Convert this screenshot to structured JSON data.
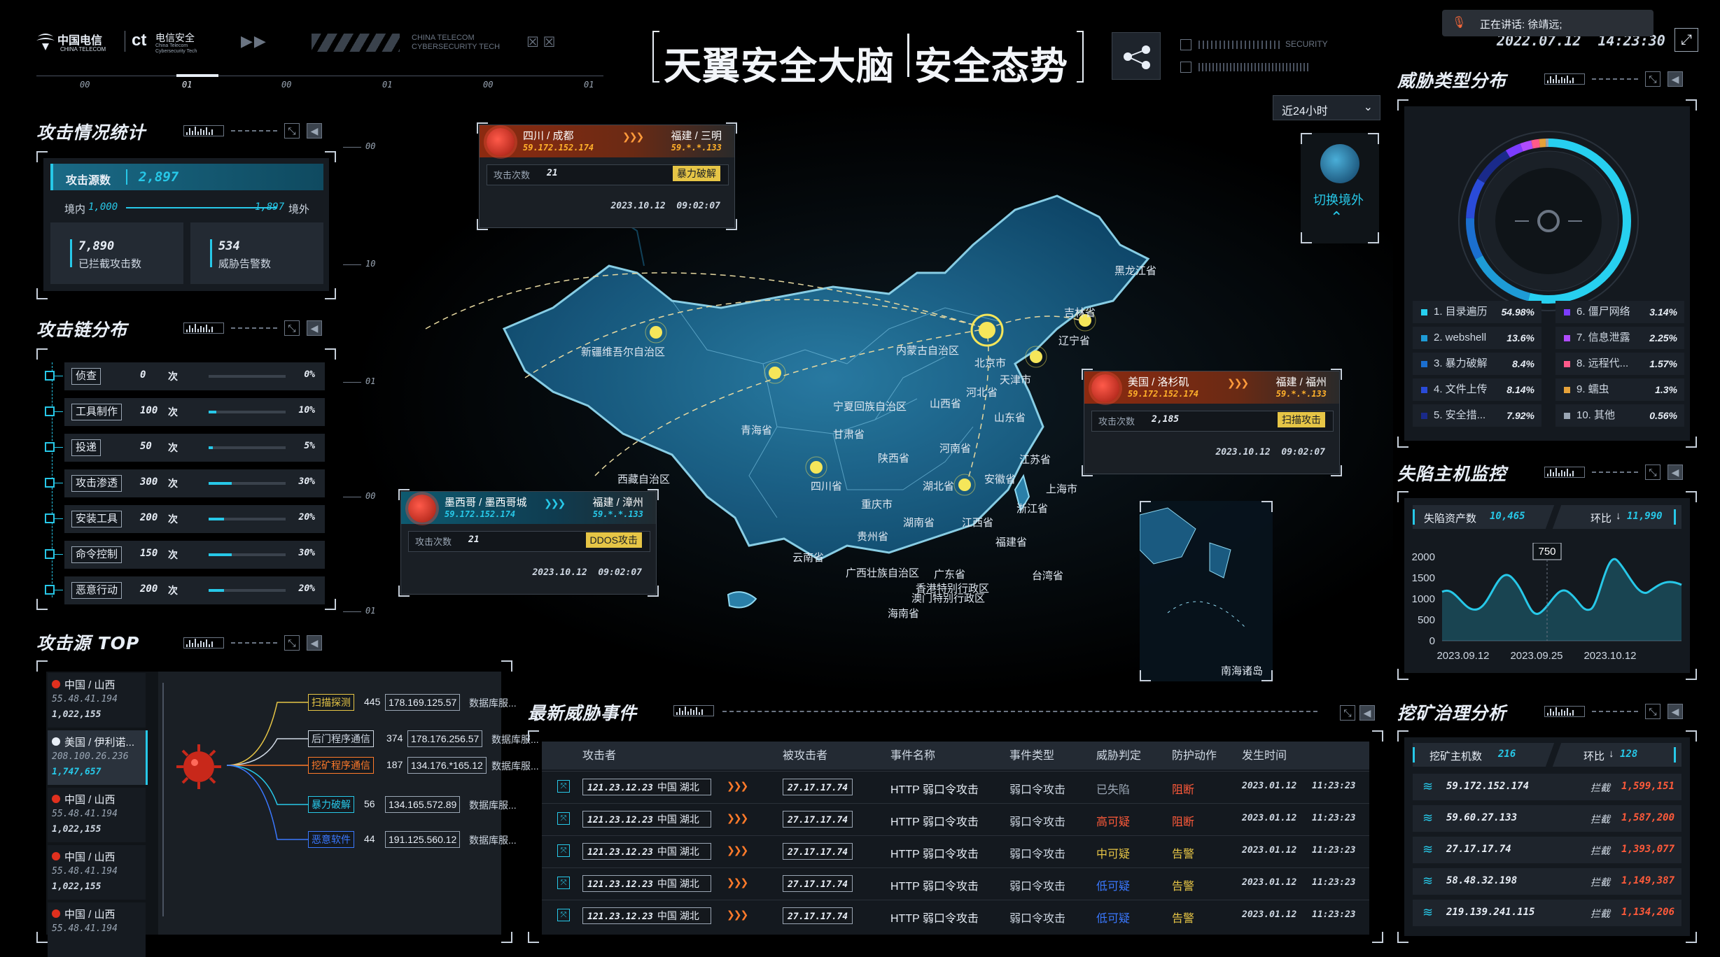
{
  "header": {
    "logo_text": "中国电信",
    "logo_sub": "CHINA TELECOM",
    "logo2_text": "电信安全",
    "logo2_sub": "China Telecom Cybersecurity Tech",
    "brand_en": "CHINA TELECOM\nCYBERSECURITY TECH",
    "title_part1": "天翼安全大脑",
    "title_part2": "安全态势",
    "security_label": "SECURITY",
    "datetime": "2022.07.12  14:23:30",
    "timeline_labels": [
      "00",
      "01",
      "00",
      "01",
      "00",
      "01"
    ],
    "speaking": "正在讲话: 徐靖远;"
  },
  "time_select": {
    "value": "近24小时"
  },
  "attack_stats": {
    "title": "攻击情况统计",
    "source_label": "攻击源数",
    "source_value": "2,897",
    "domestic_label": "境内",
    "domestic_value": "1,000",
    "foreign_value": "1,897",
    "foreign_label": "境外",
    "blocked_value": "7,890",
    "blocked_label": "已拦截攻击数",
    "alerts_value": "534",
    "alerts_label": "威胁告警数"
  },
  "attack_chain": {
    "title": "攻击链分布",
    "unit": "次",
    "items": [
      {
        "label": "侦查",
        "count": "0",
        "pct": "0%",
        "level": 0
      },
      {
        "label": "工具制作",
        "count": "100",
        "pct": "10%",
        "level": 10
      },
      {
        "label": "投递",
        "count": "50",
        "pct": "5%",
        "level": 5
      },
      {
        "label": "攻击渗透",
        "count": "300",
        "pct": "30%",
        "level": 30
      },
      {
        "label": "安装工具",
        "count": "200",
        "pct": "20%",
        "level": 20
      },
      {
        "label": "命令控制",
        "count": "150",
        "pct": "30%",
        "level": 30
      },
      {
        "label": "恶意行动",
        "count": "200",
        "pct": "20%",
        "level": 20
      }
    ]
  },
  "attack_top": {
    "title": "攻击源 TOP",
    "sources": [
      {
        "place": "中国 / 山西",
        "ip": "55.48.41.194",
        "count": "1,022,155"
      },
      {
        "place": "美国 / 伊利诺...",
        "ip": "208.100.26.236",
        "count": "1,747,657"
      },
      {
        "place": "中国 / 山西",
        "ip": "55.48.41.194",
        "count": "1,022,155"
      },
      {
        "place": "中国 / 山西",
        "ip": "55.48.41.194",
        "count": "1,022,155"
      },
      {
        "place": "中国 / 山西",
        "ip": "55.48.41.194",
        "count": ""
      }
    ],
    "branches": [
      {
        "type": "扫描探测",
        "num": "445",
        "ip": "178.169.125.57",
        "desc": "数据库服..."
      },
      {
        "type": "后门程序通信",
        "num": "374",
        "ip": "178.176.256.57",
        "desc": "数据库服..."
      },
      {
        "type": "挖矿程序通信",
        "num": "187",
        "ip": "134.176.*165.12",
        "desc": "数据库服..."
      },
      {
        "type": "暴力破解",
        "num": "56",
        "ip": "134.165.572.89",
        "desc": "数据库服..."
      },
      {
        "type": "恶意软件",
        "num": "44",
        "ip": "191.125.560.12",
        "desc": "数据库服..."
      }
    ]
  },
  "map": {
    "axis_labels": [
      "00",
      "10",
      "01",
      "00",
      "01"
    ],
    "provinces": [
      "新疆维吾尔自治区",
      "内蒙古自治区",
      "黑龙江省",
      "吉林省",
      "辽宁省",
      "北京市",
      "天津市",
      "河北省",
      "山西省",
      "山东省",
      "宁夏回族自治区",
      "甘肃省",
      "青海省",
      "陕西省",
      "河南省",
      "江苏省",
      "安徽省",
      "湖北省",
      "上海市",
      "四川省",
      "重庆市",
      "西藏自治区",
      "浙江省",
      "江西省",
      "湖南省",
      "贵州省",
      "福建省",
      "云南省",
      "广西壮族自治区",
      "广东省",
      "台湾省",
      "香港特别行政区",
      "澳门特别行政区",
      "海南省",
      "南海诸岛"
    ],
    "switch_label": "切换境外",
    "popups": [
      {
        "from": "四川 / 成都",
        "from_ip": "59.172.152.174",
        "to": "福建 / 三明",
        "to_ip": "59.*.*.133",
        "count_label": "攻击次数",
        "count": "21",
        "type": "暴力破解",
        "time": "2023.10.12  09:02:07"
      },
      {
        "from": "美国 / 洛杉矶",
        "from_ip": "59.172.152.174",
        "to": "福建 / 福州",
        "to_ip": "59.*.*.133",
        "count_label": "攻击次数",
        "count": "2,185",
        "type": "扫描攻击",
        "time": "2023.10.12  09:02:07"
      },
      {
        "from": "墨西哥 / 墨西哥城",
        "from_ip": "59.172.152.174",
        "to": "福建 / 漳州",
        "to_ip": "59.*.*.133",
        "count_label": "攻击次数",
        "count": "21",
        "type": "DDOS攻击",
        "time": "2023.10.12  09:02:07"
      }
    ]
  },
  "threat_events": {
    "title": "最新威胁事件",
    "headers": [
      "攻击者",
      "被攻击者",
      "事件名称",
      "事件类型",
      "威胁判定",
      "防护动作",
      "发生时间"
    ],
    "rows": [
      {
        "attacker": "121.23.12.23",
        "region": "中国 湖北",
        "victim": "27.17.17.74",
        "name": "HTTP 弱口令攻击",
        "type": "弱口令攻击",
        "verdict": "已失陷",
        "action": "阻断",
        "date": "2023.01.12",
        "time": "11:23:23"
      },
      {
        "attacker": "121.23.12.23",
        "region": "中国 湖北",
        "victim": "27.17.17.74",
        "name": "HTTP 弱口令攻击",
        "type": "弱口令攻击",
        "verdict": "高可疑",
        "action": "阻断",
        "date": "2023.01.12",
        "time": "11:23:23"
      },
      {
        "attacker": "121.23.12.23",
        "region": "中国 湖北",
        "victim": "27.17.17.74",
        "name": "HTTP 弱口令攻击",
        "type": "弱口令攻击",
        "verdict": "中可疑",
        "action": "告警",
        "date": "2023.01.12",
        "time": "11:23:23"
      },
      {
        "attacker": "121.23.12.23",
        "region": "中国 湖北",
        "victim": "27.17.17.74",
        "name": "HTTP 弱口令攻击",
        "type": "弱口令攻击",
        "verdict": "低可疑",
        "action": "告警",
        "date": "2023.01.12",
        "time": "11:23:23"
      },
      {
        "attacker": "121.23.12.23",
        "region": "中国 湖北",
        "victim": "27.17.17.74",
        "name": "HTTP 弱口令攻击",
        "type": "弱口令攻击",
        "verdict": "低可疑",
        "action": "告警",
        "date": "2023.01.12",
        "time": "11:23:23"
      }
    ],
    "colors": {
      "已失陷": "#9aa6b4",
      "高可疑": "#ff5a3a",
      "中可疑": "#e6c546",
      "低可疑": "#3a78ff",
      "阻断": "#ff5a3a",
      "告警": "#e6c546"
    }
  },
  "threat_types": {
    "title": "威胁类型分布",
    "items": [
      {
        "label": "1. 目录遍历",
        "value": "54.98%",
        "color": "#27d0f0"
      },
      {
        "label": "6. 僵尸网络",
        "value": "3.14%",
        "color": "#7b3cff"
      },
      {
        "label": "2. webshell",
        "value": "13.6%",
        "color": "#1e9bd6"
      },
      {
        "label": "7. 信息泄露",
        "value": "2.25%",
        "color": "#b04cff"
      },
      {
        "label": "3. 暴力破解",
        "value": "8.4%",
        "color": "#1b6fd0"
      },
      {
        "label": "8. 远程代...",
        "value": "1.57%",
        "color": "#ff5a8a"
      },
      {
        "label": "4. 文件上传",
        "value": "8.14%",
        "color": "#2a4bd8"
      },
      {
        "label": "9. 蠕虫",
        "value": "1.3%",
        "color": "#e6a23a"
      },
      {
        "label": "5. 安全措...",
        "value": "7.92%",
        "color": "#1a2a8a"
      },
      {
        "label": "10. 其他",
        "value": "0.56%",
        "color": "#9aa6b4"
      }
    ]
  },
  "fallen_hosts": {
    "title": "失陷主机监控",
    "assets_label": "失陷资产数",
    "assets_value": "10,465",
    "ring_label": "环比",
    "ring_value": "11,990",
    "tooltip": "750",
    "y_ticks": [
      "2000",
      "1500",
      "1000",
      "500",
      "0"
    ],
    "x_ticks": [
      "2023.09.12",
      "2023.09.25",
      "2023.10.12"
    ]
  },
  "mining": {
    "title": "挖矿治理分析",
    "hosts_label": "挖矿主机数",
    "hosts_value": "216",
    "ring_label": "环比",
    "ring_value": "128",
    "blocked_label": "拦截",
    "rows": [
      {
        "ip": "59.172.152.174",
        "blocked": "1,599,151"
      },
      {
        "ip": "59.60.27.133",
        "blocked": "1,587,200"
      },
      {
        "ip": "27.17.17.74",
        "blocked": "1,393,077"
      },
      {
        "ip": "58.48.32.198",
        "blocked": "1,149,387"
      },
      {
        "ip": "219.139.241.115",
        "blocked": "1,134,206"
      }
    ]
  }
}
